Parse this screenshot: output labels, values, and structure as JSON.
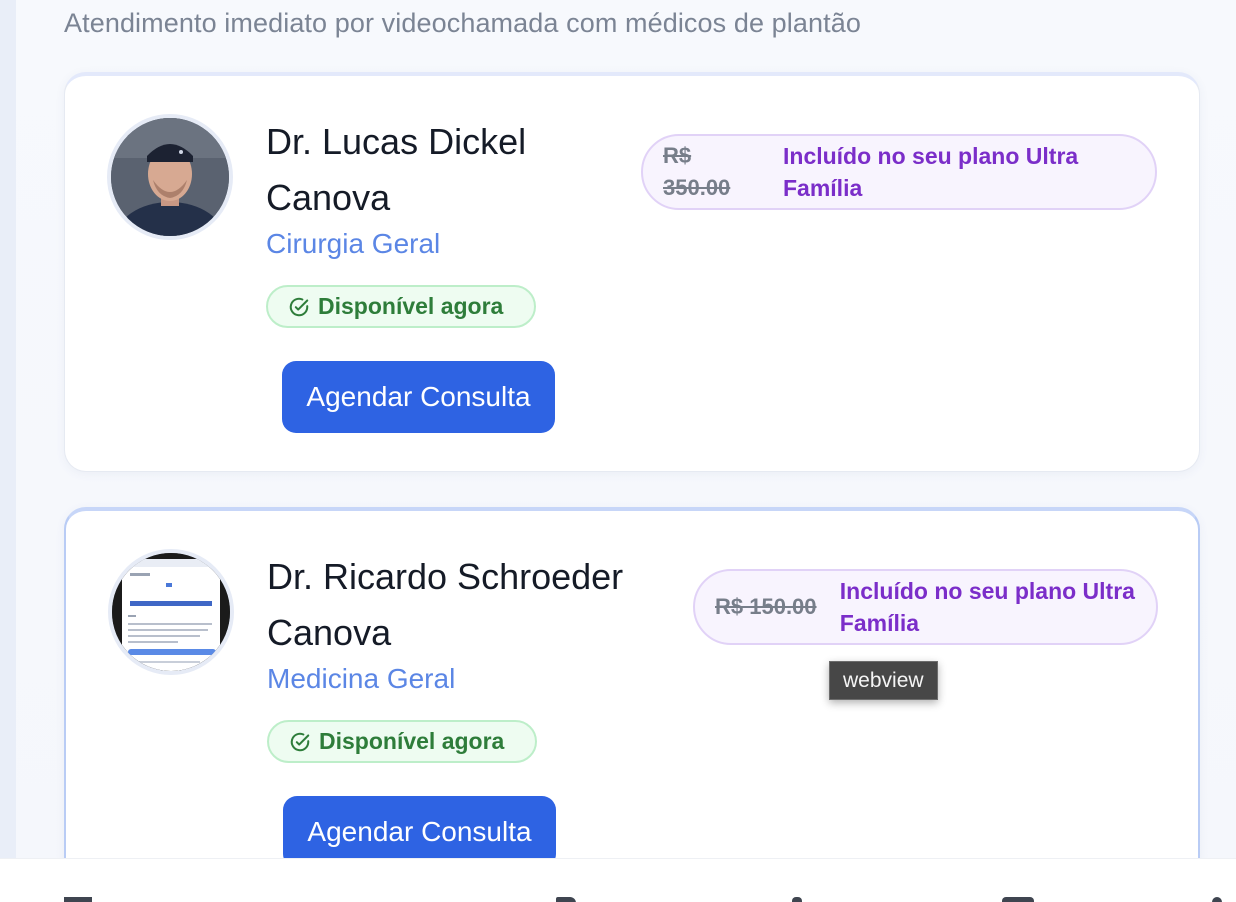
{
  "subtitle": "Atendimento imediato por videochamada com médicos de plantão",
  "doctors": [
    {
      "name": "Dr. Lucas Dickel Canova",
      "specialty": "Cirurgia Geral",
      "status": "Disponível agora",
      "old_price": "R$ 350.00",
      "plan_note": "Incluído no seu plano Ultra Família",
      "button": "Agendar Consulta"
    },
    {
      "name": "Dr. Ricardo Schroeder Canova",
      "specialty": "Medicina Geral",
      "status": "Disponível agora",
      "old_price": "R$ 150.00",
      "plan_note": "Incluído no seu plano Ultra Família",
      "button": "Agendar Consulta"
    }
  ],
  "tooltip": "webview",
  "colors": {
    "accent": "#2e63e3",
    "specialty": "#5b86e5",
    "available": "#2e7d3a",
    "plan": "#7b2ec9"
  },
  "icons": [
    "check-circle-icon",
    "doctor-photo",
    "document-thumbnail"
  ]
}
